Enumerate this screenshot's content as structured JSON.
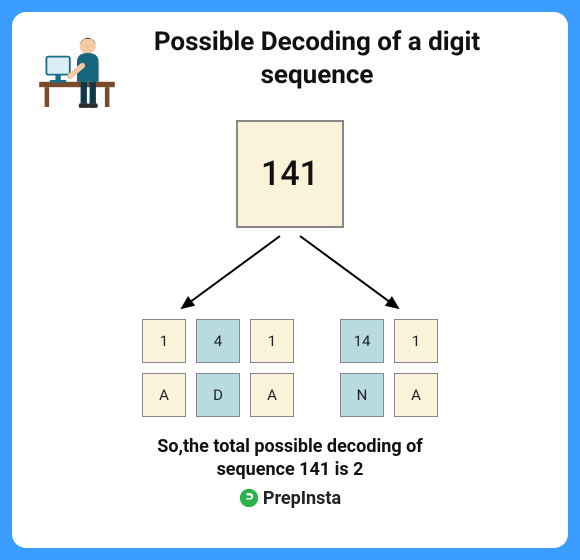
{
  "title": "Possible Decoding of a digit sequence",
  "input_sequence": "141",
  "decodings": [
    {
      "digits": [
        {
          "v": "1",
          "c": "cream"
        },
        {
          "v": "4",
          "c": "teal"
        },
        {
          "v": "1",
          "c": "cream"
        }
      ],
      "letters": [
        {
          "v": "A",
          "c": "cream"
        },
        {
          "v": "D",
          "c": "teal"
        },
        {
          "v": "A",
          "c": "cream"
        }
      ]
    },
    {
      "digits": [
        {
          "v": "14",
          "c": "teal"
        },
        {
          "v": "1",
          "c": "cream"
        }
      ],
      "letters": [
        {
          "v": "N",
          "c": "teal"
        },
        {
          "v": "A",
          "c": "cream"
        }
      ]
    }
  ],
  "caption_line1": "So,the total possible decoding of",
  "caption_line2": "sequence 141 is 2",
  "brand": "PrepInsta",
  "colors": {
    "cream": "#faf3d9",
    "teal": "#b7dbe0"
  },
  "chart_data": {
    "type": "table",
    "title": "Possible Decoding of a digit sequence",
    "input": "141",
    "decodings": [
      {
        "split": [
          "1",
          "4",
          "1"
        ],
        "letters": [
          "A",
          "D",
          "A"
        ]
      },
      {
        "split": [
          "14",
          "1"
        ],
        "letters": [
          "N",
          "A"
        ]
      }
    ],
    "total_decodings": 2
  }
}
